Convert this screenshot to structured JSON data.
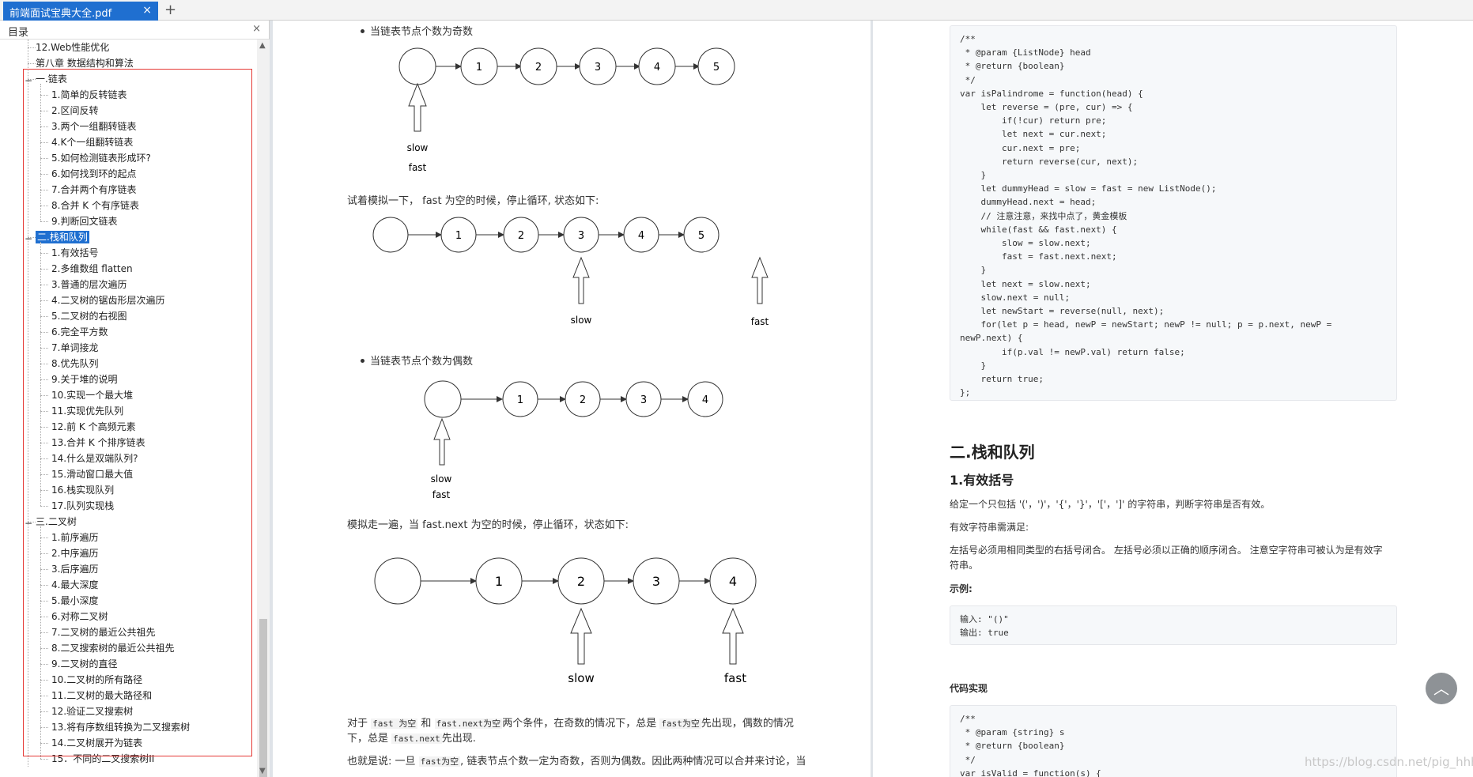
{
  "tabbar": {
    "tab_title": "前端面试宝典大全.pdf",
    "close": "×",
    "new_tab": "+"
  },
  "sidebar": {
    "title": "目录",
    "close": "×",
    "items": [
      {
        "label": "12.Web性能优化",
        "level": 1
      },
      {
        "label": "第八章 数据结构和算法",
        "level": 1
      },
      {
        "label": "一.链表",
        "level": 1,
        "toggle": "−"
      },
      {
        "label": "1.简单的反转链表",
        "level": 2
      },
      {
        "label": "2.区间反转",
        "level": 2
      },
      {
        "label": "3.两个一组翻转链表",
        "level": 2
      },
      {
        "label": "4.K个一组翻转链表",
        "level": 2
      },
      {
        "label": "5.如何检测链表形成环?",
        "level": 2
      },
      {
        "label": "6.如何找到环的起点",
        "level": 2
      },
      {
        "label": "7.合并两个有序链表",
        "level": 2
      },
      {
        "label": "8.合并 K 个有序链表",
        "level": 2
      },
      {
        "label": "9.判断回文链表",
        "level": 2
      },
      {
        "label": "二.栈和队列",
        "level": 1,
        "toggle": "−",
        "selected": true
      },
      {
        "label": "1.有效括号",
        "level": 2
      },
      {
        "label": "2.多维数组 flatten",
        "level": 2
      },
      {
        "label": "3.普通的层次遍历",
        "level": 2
      },
      {
        "label": "4.二叉树的锯齿形层次遍历",
        "level": 2
      },
      {
        "label": "5.二叉树的右视图",
        "level": 2
      },
      {
        "label": "6.完全平方数",
        "level": 2
      },
      {
        "label": "7.单词接龙",
        "level": 2
      },
      {
        "label": "8.优先队列",
        "level": 2
      },
      {
        "label": "9.关于堆的说明",
        "level": 2
      },
      {
        "label": "10.实现一个最大堆",
        "level": 2
      },
      {
        "label": "11.实现优先队列",
        "level": 2
      },
      {
        "label": "12.前 K 个高频元素",
        "level": 2
      },
      {
        "label": "13.合并 K 个排序链表",
        "level": 2
      },
      {
        "label": "14.什么是双端队列?",
        "level": 2
      },
      {
        "label": "15.滑动窗口最大值",
        "level": 2
      },
      {
        "label": "16.栈实现队列",
        "level": 2
      },
      {
        "label": "17.队列实现栈",
        "level": 2
      },
      {
        "label": "三.二叉树",
        "level": 1,
        "toggle": "−"
      },
      {
        "label": "1.前序遍历",
        "level": 2
      },
      {
        "label": "2.中序遍历",
        "level": 2
      },
      {
        "label": "3.后序遍历",
        "level": 2
      },
      {
        "label": "4.最大深度",
        "level": 2
      },
      {
        "label": "5.最小深度",
        "level": 2
      },
      {
        "label": "6.对称二叉树",
        "level": 2
      },
      {
        "label": "7.二叉树的最近公共祖先",
        "level": 2
      },
      {
        "label": "8.二叉搜索树的最近公共祖先",
        "level": 2
      },
      {
        "label": "9.二叉树的直径",
        "level": 2
      },
      {
        "label": "10.二叉树的所有路径",
        "level": 2
      },
      {
        "label": "11.二叉树的最大路径和",
        "level": 2
      },
      {
        "label": "12.验证二叉搜索树",
        "level": 2
      },
      {
        "label": "13.将有序数组转换为二叉搜索树",
        "level": 2
      },
      {
        "label": "14.二叉树展开为链表",
        "level": 2
      },
      {
        "label": "15．不同的二叉搜索树II",
        "level": 2
      }
    ]
  },
  "page1": {
    "bullet1": "当链表节点个数为奇数",
    "slow": "slow",
    "fast": "fast",
    "para1": "试着模拟一下， fast 为空的时候，停止循环, 状态如下:",
    "bullet2": "当链表节点个数为偶数",
    "para2": "模拟走一遍，当 fast.next 为空的时候，停止循环，状态如下:",
    "nums": {
      "n1": "1",
      "n2": "2",
      "n3": "3",
      "n4": "4",
      "n5": "5"
    },
    "p3a": "对于",
    "p3b": "fast 为空",
    "p3c": "和",
    "p3d": "fast.next为空",
    "p3e": "两个条件，在奇数的情况下，总是",
    "p3f": "fast为空",
    "p3g": "先出现，偶数的情况",
    "p3h": "下，总是",
    "p3i": "fast.next",
    "p3j": "先出现.",
    "p4a": "也就是说: 一旦",
    "p4b": "fast为空",
    "p4c": ", 链表节点个数一定为奇数，否则为偶数。因此两种情况可以合并来讨论，当"
  },
  "page2": {
    "code1": "/**\n * @param {ListNode} head\n * @return {boolean}\n */\nvar isPalindrome = function(head) {\n    let reverse = (pre, cur) => {\n        if(!cur) return pre;\n        let next = cur.next;\n        cur.next = pre;\n        return reverse(cur, next);\n    }\n    let dummyHead = slow = fast = new ListNode();\n    dummyHead.next = head;\n    // 注意注意，来找中点了，黄金模板\n    while(fast && fast.next) {\n        slow = slow.next;\n        fast = fast.next.next;\n    }\n    let next = slow.next;\n    slow.next = null;\n    let newStart = reverse(null, next);\n    for(let p = head, newP = newStart; newP != null; p = p.next, newP =\nnewP.next) {\n        if(p.val != newP.val) return false;\n    }\n    return true;\n};",
    "h2": "二.栈和队列",
    "h3": "1.有效括号",
    "p1": "给定一个只包括 '('，')'，'{'，'}'，'['，']' 的字符串，判断字符串是否有效。",
    "p2": "有效字符串需满足:",
    "p3a": "左括号必须用相同类型的右括号闭合。 左括号必须以正确的顺序闭合。 注意空字符串可被认为是有效字",
    "p3b": "符串。",
    "example": "示例:",
    "code2": "输入: \"()\"\n输出: true",
    "impl": "代码实现",
    "code3": "/**\n * @param {string} s\n * @return {boolean}\n */\nvar isValid = function(s) {",
    "watermark": "https://blog.csdn.net/pig_hhh"
  },
  "totop": "︿"
}
